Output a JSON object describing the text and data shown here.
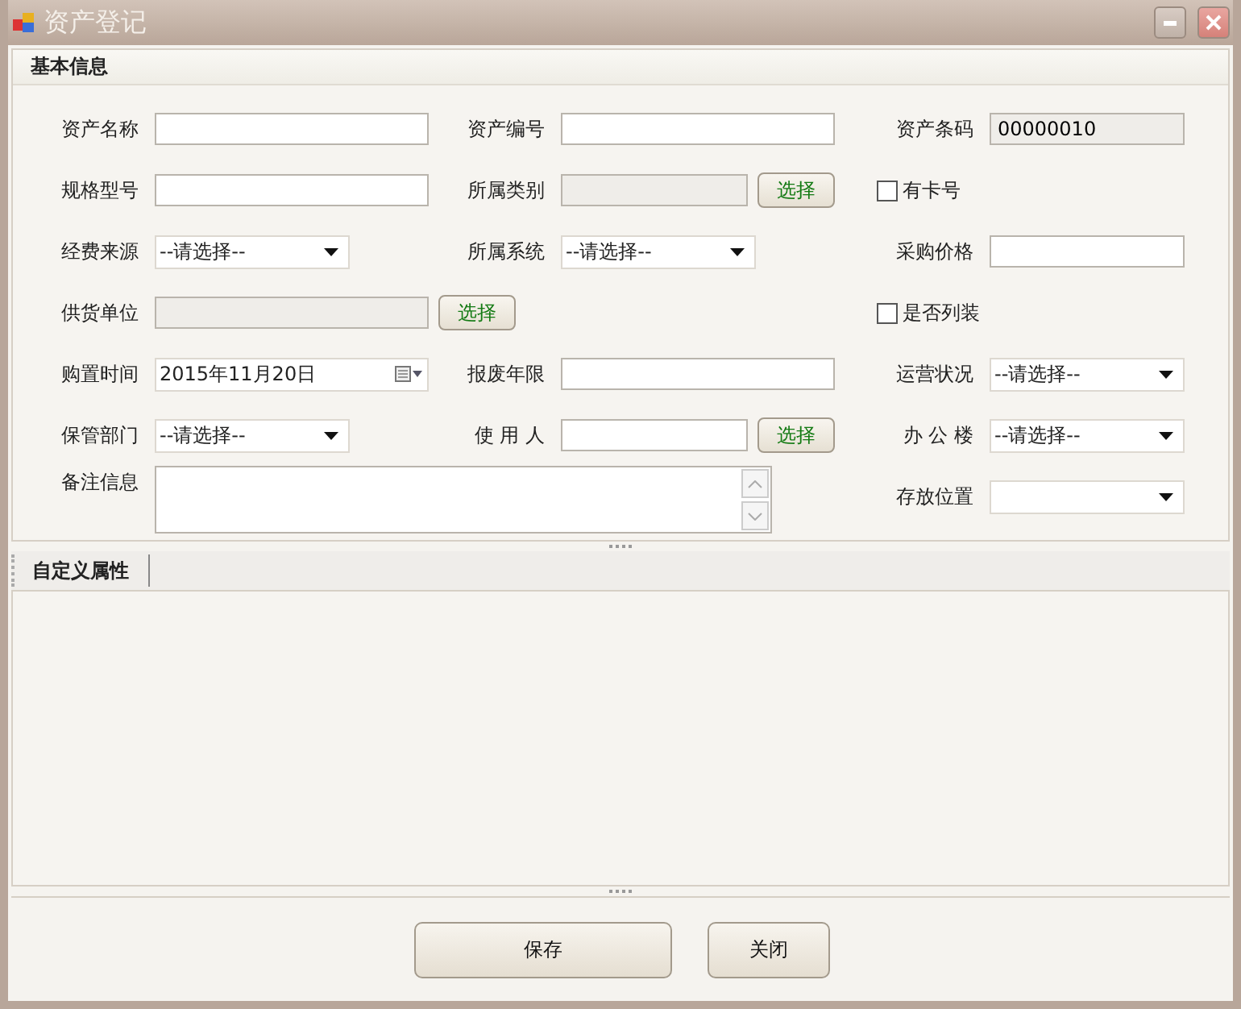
{
  "window": {
    "title": "资产登记"
  },
  "basic": {
    "title": "基本信息",
    "rows": [
      {
        "left": {
          "kind": "text",
          "label": "资产名称"
        },
        "middle": {
          "kind": "text",
          "label": "资产编号"
        },
        "right": {
          "kind": "readonly",
          "label": "资产条码",
          "value": "00000010"
        }
      },
      {
        "left": {
          "kind": "text",
          "label": "规格型号"
        },
        "middle": {
          "kind": "picker",
          "label": "所属类别",
          "button": "选择"
        },
        "right": {
          "kind": "checkbox",
          "label": "有卡号",
          "checked": false
        }
      },
      {
        "left": {
          "kind": "select",
          "label": "经费来源",
          "value": "--请选择--"
        },
        "middle": {
          "kind": "select",
          "label": "所属系统",
          "value": "--请选择--"
        },
        "right": {
          "kind": "text",
          "label": "采购价格"
        }
      },
      {
        "left": {
          "kind": "picker",
          "label": "供货单位",
          "button": "选择"
        },
        "right": {
          "kind": "checkbox",
          "label": "是否列装",
          "checked": false
        }
      },
      {
        "left": {
          "kind": "date",
          "label": "购置时间",
          "value": "2015年11月20日"
        },
        "middle": {
          "kind": "text",
          "label": "报废年限"
        },
        "right": {
          "kind": "select",
          "label": "运营状况",
          "value": "--请选择--"
        }
      },
      {
        "left": {
          "kind": "select",
          "label": "保管部门",
          "value": "--请选择--"
        },
        "middle": {
          "kind": "textpicker",
          "label": "使 用 人",
          "button": "选择"
        },
        "right": {
          "kind": "select",
          "label": "办 公 楼",
          "value": "--请选择--"
        }
      },
      {
        "left": {
          "kind": "textarea",
          "label": "备注信息"
        },
        "right": {
          "kind": "select",
          "label": "存放位置"
        }
      }
    ]
  },
  "custom": {
    "title": "自定义属性"
  },
  "buttons": [
    {
      "label": "保存",
      "kind": "wide"
    },
    {
      "label": "关闭",
      "kind": "narrow"
    }
  ]
}
